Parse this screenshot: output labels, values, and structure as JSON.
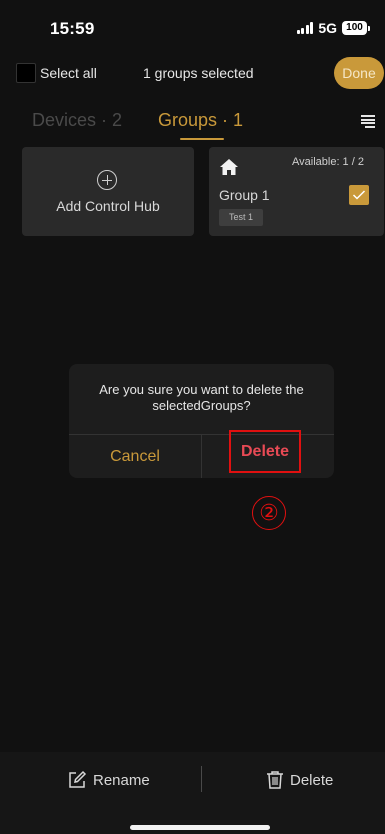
{
  "status_bar": {
    "time": "15:59",
    "network": "5G",
    "battery": "100"
  },
  "selection_header": {
    "select_all_label": "Select all",
    "selected_count": "1 groups selected",
    "done_label": "Done"
  },
  "tabs": [
    {
      "label": "Devices · 2",
      "active": false
    },
    {
      "label": "Groups · 1",
      "active": true
    }
  ],
  "cards": {
    "add": {
      "label": "Add Control Hub",
      "icon": "plus-circle-icon"
    },
    "group": {
      "name": "Group 1",
      "tag": "Test 1",
      "available": "Available: 1 / 2",
      "checked": true,
      "icon": "home-icon"
    }
  },
  "dialog": {
    "message": "Are you sure you want to delete the selectedGroups?",
    "cancel_label": "Cancel",
    "delete_label": "Delete"
  },
  "annotation": {
    "label": "②"
  },
  "bottom_bar": {
    "rename_label": "Rename",
    "delete_label": "Delete"
  },
  "colors": {
    "accent": "#c9993a",
    "danger": "#e84a55",
    "background": "#111111",
    "card": "#2a2a2a"
  }
}
